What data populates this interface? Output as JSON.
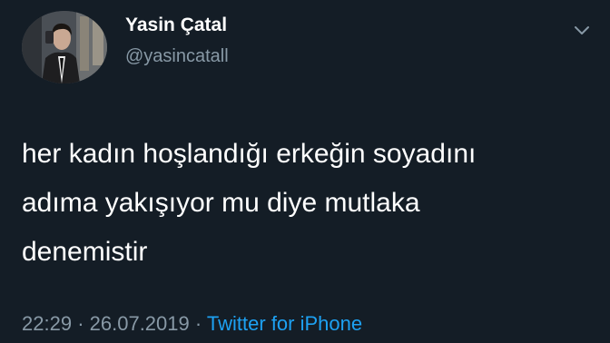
{
  "author": {
    "display_name": "Yasin Çatal",
    "handle": "@yasincatall",
    "avatar_icon": "profile-photo"
  },
  "menu": {
    "icon": "chevron-down-icon"
  },
  "tweet": {
    "lines": [
      "her kadın hoşlandığı erkeğin soyadını",
      "adıma yakışıyor mu diye mutlaka",
      "denemistir"
    ]
  },
  "meta": {
    "time": "22:29",
    "separator1": "·",
    "date": "26.07.2019",
    "separator2": "·",
    "source": "Twitter for iPhone"
  },
  "colors": {
    "background": "#141d26",
    "text": "#ffffff",
    "muted": "#8899a6",
    "link": "#1da1f2"
  }
}
